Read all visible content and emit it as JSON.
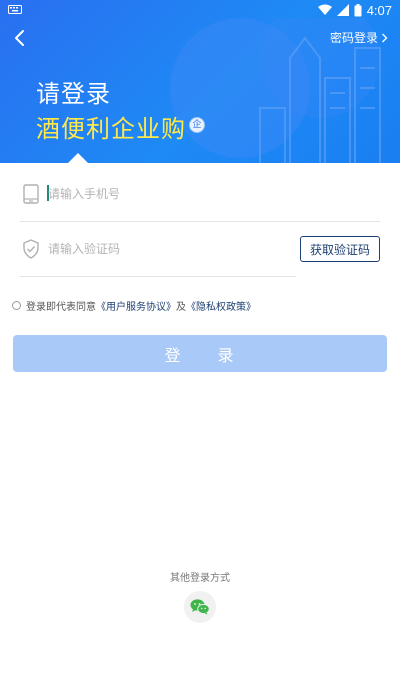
{
  "status_bar": {
    "time": "4:07"
  },
  "header": {
    "password_login": "密码登录",
    "title": "请登录",
    "subtitle": "酒便利企业购",
    "badge": "企"
  },
  "form": {
    "phone_placeholder": "请输入手机号",
    "code_placeholder": "请输入验证码",
    "get_code": "获取验证码"
  },
  "agreement": {
    "prefix": "登录即代表同意",
    "terms": "《用户服务协议》",
    "and": "及",
    "privacy": "《隐私权政策》"
  },
  "login_button": "登 录",
  "other_login": {
    "label": "其他登录方式",
    "icon": "wechat-icon"
  },
  "colors": {
    "header_blue": "#1e7ff2",
    "title_yellow": "#ffe84a",
    "button_disabled": "#a9c9f8",
    "link_navy": "#1d3f73"
  }
}
